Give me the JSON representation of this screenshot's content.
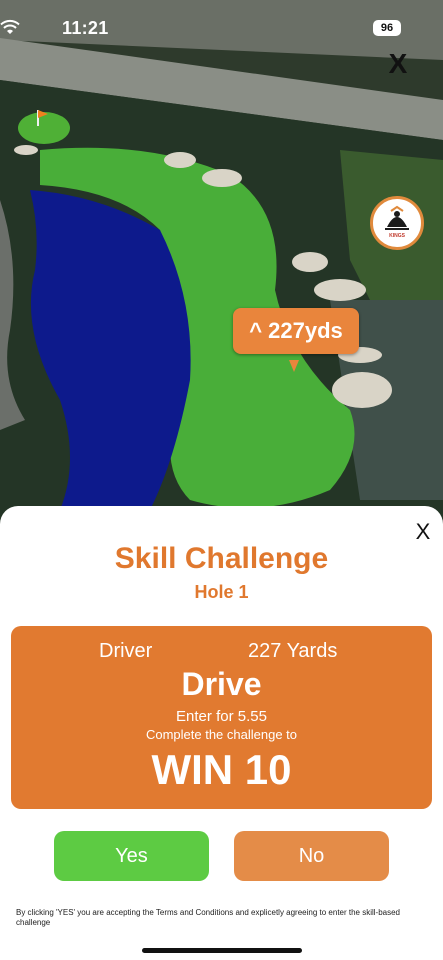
{
  "status_bar": {
    "time": "11:21",
    "battery": "96"
  },
  "map": {
    "close_label": "X",
    "distance_label": "^ 227yds",
    "badge_text": "KINGS"
  },
  "sheet": {
    "close_label": "X",
    "title": "Skill Challenge",
    "hole": "Hole 1",
    "card": {
      "club": "Driver",
      "yards": "227 Yards",
      "shot": "Drive",
      "entry": "Enter for 5.55",
      "complete": "Complete the challenge to",
      "prize": "WIN 10"
    },
    "yes_label": "Yes",
    "no_label": "No",
    "legal": "By clicking 'YES' you are accepting the Terms and Conditions and explicetly agreeing to enter the skill-based challenge"
  },
  "colors": {
    "accent": "#e17a30",
    "yes": "#5dcb43",
    "no": "#e48c48"
  },
  "icons": [
    "wifi-icon",
    "battery-icon",
    "close-icon",
    "flag-icon",
    "course-logo-icon"
  ]
}
